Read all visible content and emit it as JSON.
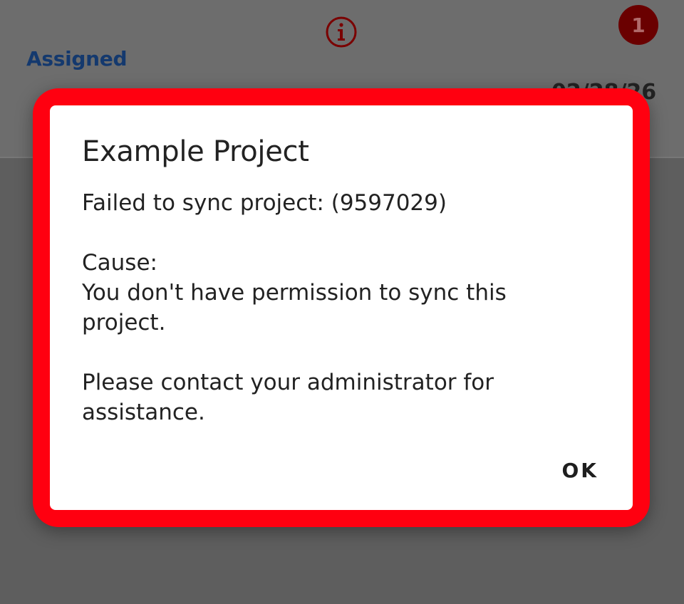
{
  "background_card": {
    "status": "Assigned",
    "badge_count": "1",
    "date": "02/28/26",
    "info_icon": "info-circle-icon"
  },
  "dialog": {
    "title": "Example Project",
    "message_line1": "Failed to sync project: (9597029)",
    "cause_label": "Cause:",
    "cause_text": "You don't have permission to sync this project.",
    "help_text": "Please contact your administrator for assistance.",
    "ok_label": "OK"
  },
  "colors": {
    "highlight": "#ff0010",
    "status_text": "#14396e",
    "badge": "#6a0000",
    "info_icon": "#7a0000"
  }
}
